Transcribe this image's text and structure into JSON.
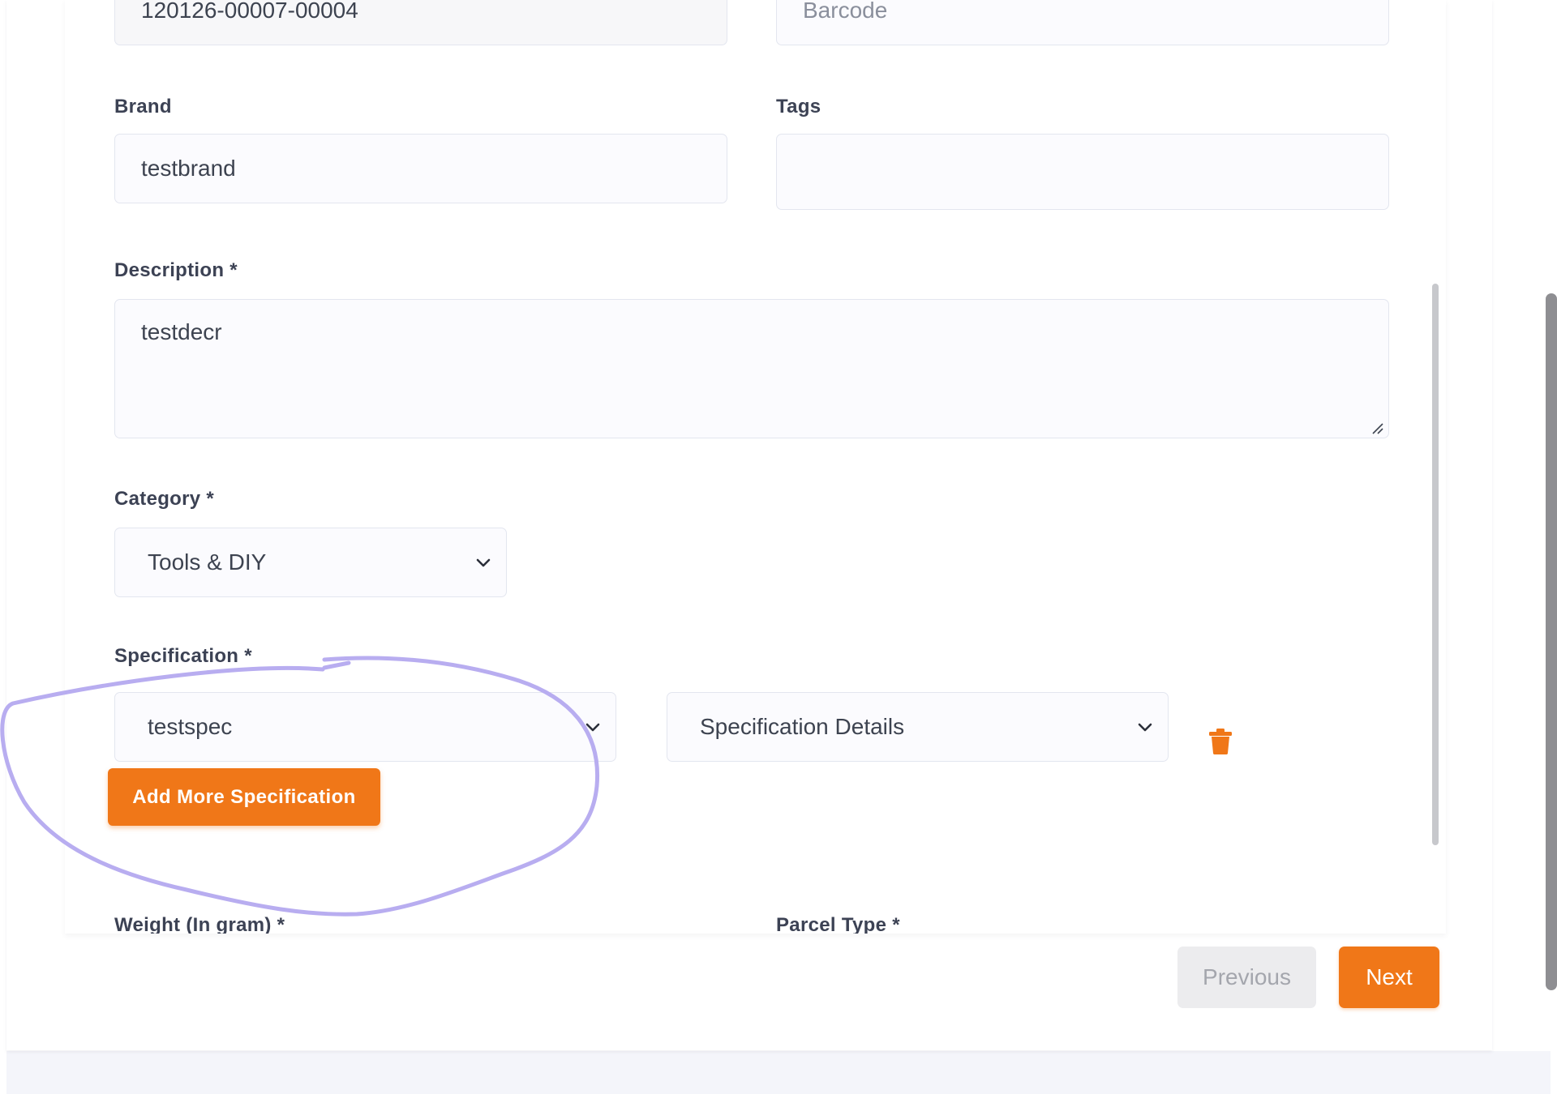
{
  "form": {
    "sku": {
      "value": "120126-00007-00004"
    },
    "barcode": {
      "placeholder": "Barcode"
    },
    "brand": {
      "label": "Brand",
      "value": "testbrand"
    },
    "tags": {
      "label": "Tags",
      "value": ""
    },
    "description": {
      "label": "Description *",
      "value": "testdecr"
    },
    "category": {
      "label": "Category *",
      "selected": "Tools & DIY"
    },
    "specification": {
      "label": "Specification *",
      "name_selected": "testspec",
      "details_selected": "Specification Details",
      "add_button_label": "Add More Specification"
    },
    "weight": {
      "label": "Weight (In gram) *"
    },
    "parcel_type": {
      "label": "Parcel Type *"
    }
  },
  "navigation": {
    "previous_label": "Previous",
    "next_label": "Next"
  },
  "colors": {
    "accent": "#f07718",
    "annotation_stroke": "#b8adf0",
    "disabled_button_bg": "#ececee"
  },
  "icons": {
    "delete": "trash-icon",
    "select_arrow": "chevron-down-icon",
    "resize": "resize-handle-icon"
  }
}
